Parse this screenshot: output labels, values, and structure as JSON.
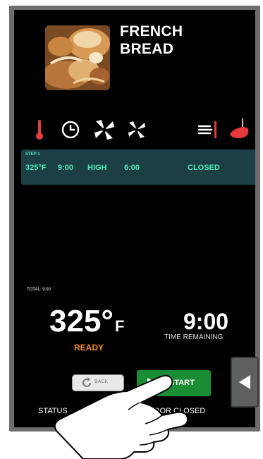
{
  "recipe": {
    "name_line1": "FRENCH",
    "name_line2": "BREAD",
    "image": "french-bread-photo"
  },
  "parameter_icons": [
    "thermometer-icon",
    "clock-icon",
    "fan-high-icon",
    "fan-low-icon",
    "vent-icon",
    "probe-icon"
  ],
  "step": {
    "label": "STEP 1",
    "temperature": "325°F",
    "time": "9:00",
    "fan": "HIGH",
    "fan_time": "6:00",
    "vent": "CLOSED"
  },
  "cook": {
    "total": "TOTAL: 9:00",
    "temperature_value": "325°",
    "temperature_unit": "F",
    "state": "READY",
    "time_value": "9:00",
    "time_label": "TIME REMAINING"
  },
  "buttons": {
    "back": "BACK",
    "start": "START"
  },
  "status": {
    "label": "STATUS",
    "door": "DOOR CLOSED"
  },
  "colors": {
    "accent": "#4fe7b8",
    "ready": "#f28b1e",
    "start": "#1a8c33",
    "icon_red": "#e8393f"
  }
}
